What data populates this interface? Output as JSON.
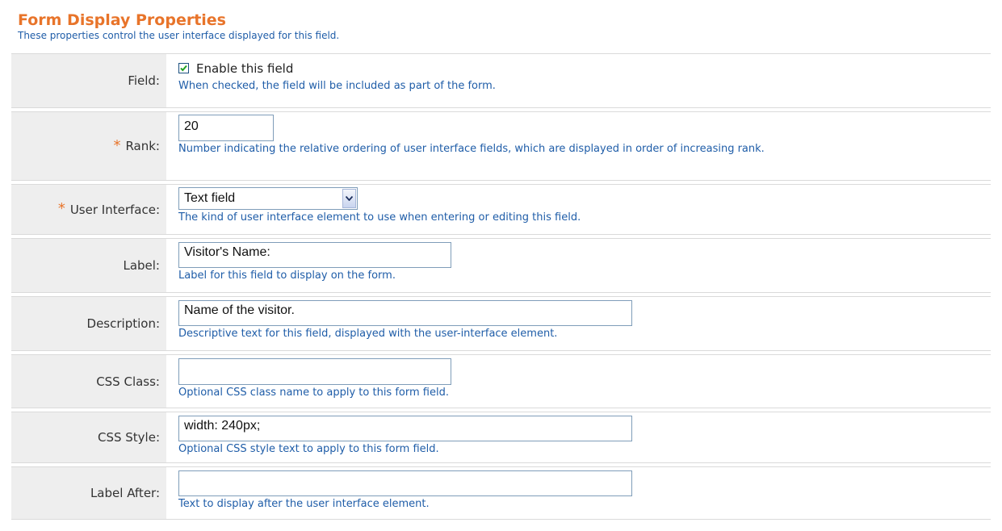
{
  "section": {
    "title": "Form Display Properties",
    "subtitle": "These properties control the user interface displayed for this field."
  },
  "fields": {
    "field": {
      "label": "Field:",
      "checkbox_label": "Enable this field",
      "checked": true,
      "help": "When checked, the field will be included as part of the form."
    },
    "rank": {
      "required_marker": "*",
      "label": "Rank:",
      "value": "20",
      "help": "Number indicating the relative ordering of user interface fields, which are displayed in order of increasing rank."
    },
    "user_interface": {
      "required_marker": "*",
      "label": "User Interface:",
      "selected": "Text field",
      "help": "The kind of user interface element to use when entering or editing this field."
    },
    "label_field": {
      "label": "Label:",
      "value": "Visitor's Name:",
      "help": "Label for this field to display on the form."
    },
    "description": {
      "label": "Description:",
      "value": "Name of the visitor.",
      "help": "Descriptive text for this field, displayed with the user-interface element."
    },
    "css_class": {
      "label": "CSS Class:",
      "value": "",
      "help": "Optional CSS class name to apply to this form field."
    },
    "css_style": {
      "label": "CSS Style:",
      "value": "width: 240px;",
      "help": "Optional CSS style text to apply to this form field."
    },
    "label_after": {
      "label": "Label After:",
      "value": "",
      "help": "Text to display after the user interface element."
    }
  },
  "colors": {
    "title": "#e8742a",
    "help_text": "#1f5da8",
    "label_bg": "#eeeeee",
    "required": "#e8742a",
    "input_border": "#7f9db9"
  }
}
